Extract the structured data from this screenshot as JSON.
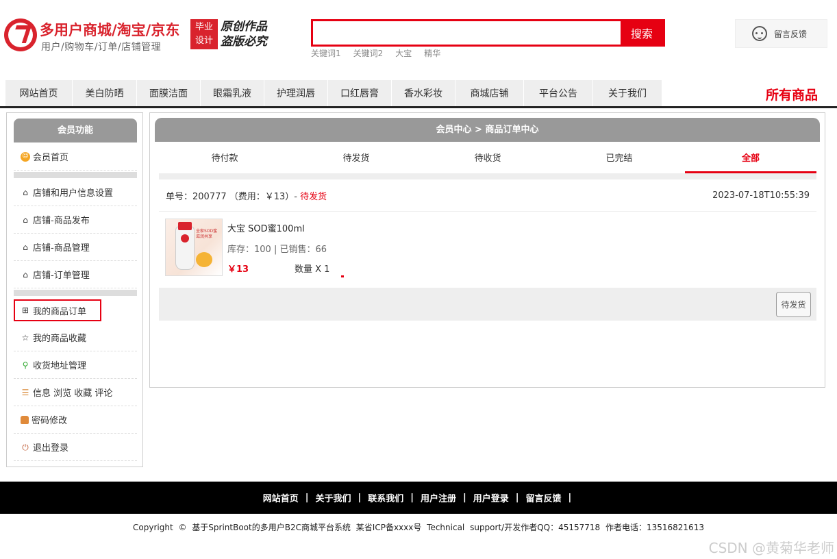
{
  "header": {
    "title": "多用户商城/淘宝/京东",
    "subtitle": "用户/购物车/订单/店铺管理",
    "badge": [
      "毕业",
      "设计"
    ],
    "slogan": "原创作品盗版必究",
    "search": {
      "placeholder": "",
      "button": "搜索"
    },
    "keywords": [
      "关键词1",
      "关键词2",
      "大宝",
      "精华"
    ],
    "feedback": "留言反馈"
  },
  "nav": {
    "items": [
      "网站首页",
      "美白防晒",
      "面膜洁面",
      "眼霜乳液",
      "护理润唇",
      "口红唇膏",
      "香水彩妆",
      "商城店铺",
      "平台公告",
      "关于我们"
    ],
    "all_products": "所有商品"
  },
  "sidebar": {
    "title": "会员功能",
    "items": [
      {
        "label": "会员首页",
        "icon": "user-home-icon"
      },
      {
        "label": "店铺和用户信息设置",
        "icon": "home-icon"
      },
      {
        "label": "店铺-商品发布",
        "icon": "home-icon"
      },
      {
        "label": "店铺-商品管理",
        "icon": "home-icon"
      },
      {
        "label": "店铺-订单管理",
        "icon": "home-icon"
      },
      {
        "label": "我的商品订单",
        "icon": "grid-icon"
      },
      {
        "label": "我的商品收藏",
        "icon": "star-icon"
      },
      {
        "label": "收货地址管理",
        "icon": "map-pin-icon"
      },
      {
        "label": "信息 浏览 收藏 评论",
        "icon": "list-icon"
      },
      {
        "label": "密码修改",
        "icon": "lock-icon"
      },
      {
        "label": "退出登录",
        "icon": "power-icon"
      }
    ]
  },
  "main": {
    "breadcrumb": "会员中心 > 商品订单中心",
    "tabs": [
      "待付款",
      "待发货",
      "待收货",
      "已完结",
      "全部"
    ],
    "active_tab": "全部",
    "order": {
      "number_text": "单号：200777 （费用：￥13）-",
      "status": "待发货",
      "time": "2023-07-18T10:55:39",
      "product_name": "大宝 SOD蜜100ml",
      "stock_text": "库存：100 | 已销售：66",
      "price": "￥13",
      "quantity": "数量 X 1",
      "image_text": "全家SOD蜜 滋润共享",
      "action": "待发货"
    }
  },
  "footer": {
    "links": [
      "网站首页",
      "关于我们",
      "联系我们",
      "用户注册",
      "用户登录",
      "留言反馈"
    ],
    "copyright": "Copyright © 基于SprintBoot的多用户B2C商城平台系统   某省ICP备xxxx号   Technical support/开发作者QQ：45157718   作者电话：13516821613",
    "watermark": "CSDN @黄菊华老师"
  },
  "colors": {
    "accent": "#e60012",
    "brand": "#d9232d",
    "panel_gray": "#999999"
  }
}
